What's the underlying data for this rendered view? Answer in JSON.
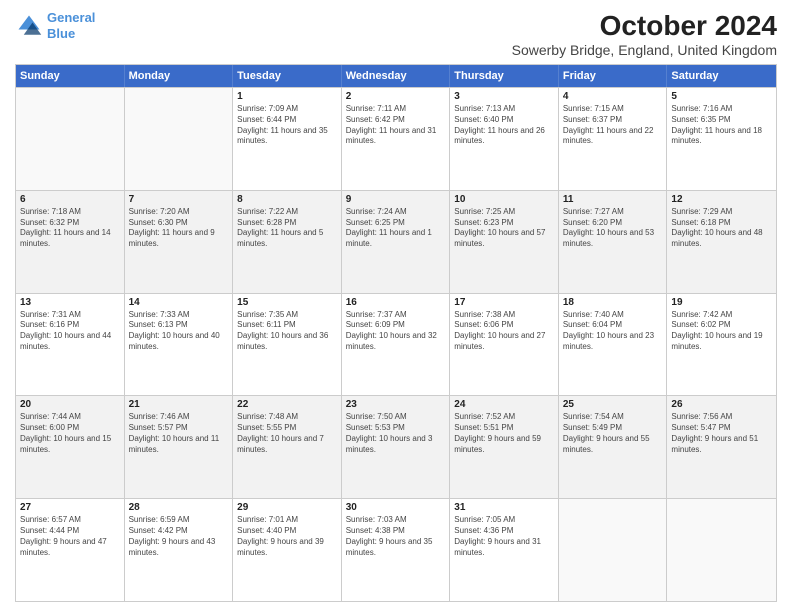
{
  "header": {
    "logo_line1": "General",
    "logo_line2": "Blue",
    "month_title": "October 2024",
    "location": "Sowerby Bridge, England, United Kingdom"
  },
  "days_of_week": [
    "Sunday",
    "Monday",
    "Tuesday",
    "Wednesday",
    "Thursday",
    "Friday",
    "Saturday"
  ],
  "weeks": [
    [
      {
        "day": "",
        "empty": true
      },
      {
        "day": "",
        "empty": true
      },
      {
        "day": "1",
        "sunrise": "Sunrise: 7:09 AM",
        "sunset": "Sunset: 6:44 PM",
        "daylight": "Daylight: 11 hours and 35 minutes."
      },
      {
        "day": "2",
        "sunrise": "Sunrise: 7:11 AM",
        "sunset": "Sunset: 6:42 PM",
        "daylight": "Daylight: 11 hours and 31 minutes."
      },
      {
        "day": "3",
        "sunrise": "Sunrise: 7:13 AM",
        "sunset": "Sunset: 6:40 PM",
        "daylight": "Daylight: 11 hours and 26 minutes."
      },
      {
        "day": "4",
        "sunrise": "Sunrise: 7:15 AM",
        "sunset": "Sunset: 6:37 PM",
        "daylight": "Daylight: 11 hours and 22 minutes."
      },
      {
        "day": "5",
        "sunrise": "Sunrise: 7:16 AM",
        "sunset": "Sunset: 6:35 PM",
        "daylight": "Daylight: 11 hours and 18 minutes."
      }
    ],
    [
      {
        "day": "6",
        "sunrise": "Sunrise: 7:18 AM",
        "sunset": "Sunset: 6:32 PM",
        "daylight": "Daylight: 11 hours and 14 minutes."
      },
      {
        "day": "7",
        "sunrise": "Sunrise: 7:20 AM",
        "sunset": "Sunset: 6:30 PM",
        "daylight": "Daylight: 11 hours and 9 minutes."
      },
      {
        "day": "8",
        "sunrise": "Sunrise: 7:22 AM",
        "sunset": "Sunset: 6:28 PM",
        "daylight": "Daylight: 11 hours and 5 minutes."
      },
      {
        "day": "9",
        "sunrise": "Sunrise: 7:24 AM",
        "sunset": "Sunset: 6:25 PM",
        "daylight": "Daylight: 11 hours and 1 minute."
      },
      {
        "day": "10",
        "sunrise": "Sunrise: 7:25 AM",
        "sunset": "Sunset: 6:23 PM",
        "daylight": "Daylight: 10 hours and 57 minutes."
      },
      {
        "day": "11",
        "sunrise": "Sunrise: 7:27 AM",
        "sunset": "Sunset: 6:20 PM",
        "daylight": "Daylight: 10 hours and 53 minutes."
      },
      {
        "day": "12",
        "sunrise": "Sunrise: 7:29 AM",
        "sunset": "Sunset: 6:18 PM",
        "daylight": "Daylight: 10 hours and 48 minutes."
      }
    ],
    [
      {
        "day": "13",
        "sunrise": "Sunrise: 7:31 AM",
        "sunset": "Sunset: 6:16 PM",
        "daylight": "Daylight: 10 hours and 44 minutes."
      },
      {
        "day": "14",
        "sunrise": "Sunrise: 7:33 AM",
        "sunset": "Sunset: 6:13 PM",
        "daylight": "Daylight: 10 hours and 40 minutes."
      },
      {
        "day": "15",
        "sunrise": "Sunrise: 7:35 AM",
        "sunset": "Sunset: 6:11 PM",
        "daylight": "Daylight: 10 hours and 36 minutes."
      },
      {
        "day": "16",
        "sunrise": "Sunrise: 7:37 AM",
        "sunset": "Sunset: 6:09 PM",
        "daylight": "Daylight: 10 hours and 32 minutes."
      },
      {
        "day": "17",
        "sunrise": "Sunrise: 7:38 AM",
        "sunset": "Sunset: 6:06 PM",
        "daylight": "Daylight: 10 hours and 27 minutes."
      },
      {
        "day": "18",
        "sunrise": "Sunrise: 7:40 AM",
        "sunset": "Sunset: 6:04 PM",
        "daylight": "Daylight: 10 hours and 23 minutes."
      },
      {
        "day": "19",
        "sunrise": "Sunrise: 7:42 AM",
        "sunset": "Sunset: 6:02 PM",
        "daylight": "Daylight: 10 hours and 19 minutes."
      }
    ],
    [
      {
        "day": "20",
        "sunrise": "Sunrise: 7:44 AM",
        "sunset": "Sunset: 6:00 PM",
        "daylight": "Daylight: 10 hours and 15 minutes."
      },
      {
        "day": "21",
        "sunrise": "Sunrise: 7:46 AM",
        "sunset": "Sunset: 5:57 PM",
        "daylight": "Daylight: 10 hours and 11 minutes."
      },
      {
        "day": "22",
        "sunrise": "Sunrise: 7:48 AM",
        "sunset": "Sunset: 5:55 PM",
        "daylight": "Daylight: 10 hours and 7 minutes."
      },
      {
        "day": "23",
        "sunrise": "Sunrise: 7:50 AM",
        "sunset": "Sunset: 5:53 PM",
        "daylight": "Daylight: 10 hours and 3 minutes."
      },
      {
        "day": "24",
        "sunrise": "Sunrise: 7:52 AM",
        "sunset": "Sunset: 5:51 PM",
        "daylight": "Daylight: 9 hours and 59 minutes."
      },
      {
        "day": "25",
        "sunrise": "Sunrise: 7:54 AM",
        "sunset": "Sunset: 5:49 PM",
        "daylight": "Daylight: 9 hours and 55 minutes."
      },
      {
        "day": "26",
        "sunrise": "Sunrise: 7:56 AM",
        "sunset": "Sunset: 5:47 PM",
        "daylight": "Daylight: 9 hours and 51 minutes."
      }
    ],
    [
      {
        "day": "27",
        "sunrise": "Sunrise: 6:57 AM",
        "sunset": "Sunset: 4:44 PM",
        "daylight": "Daylight: 9 hours and 47 minutes."
      },
      {
        "day": "28",
        "sunrise": "Sunrise: 6:59 AM",
        "sunset": "Sunset: 4:42 PM",
        "daylight": "Daylight: 9 hours and 43 minutes."
      },
      {
        "day": "29",
        "sunrise": "Sunrise: 7:01 AM",
        "sunset": "Sunset: 4:40 PM",
        "daylight": "Daylight: 9 hours and 39 minutes."
      },
      {
        "day": "30",
        "sunrise": "Sunrise: 7:03 AM",
        "sunset": "Sunset: 4:38 PM",
        "daylight": "Daylight: 9 hours and 35 minutes."
      },
      {
        "day": "31",
        "sunrise": "Sunrise: 7:05 AM",
        "sunset": "Sunset: 4:36 PM",
        "daylight": "Daylight: 9 hours and 31 minutes."
      },
      {
        "day": "",
        "empty": true
      },
      {
        "day": "",
        "empty": true
      }
    ]
  ]
}
